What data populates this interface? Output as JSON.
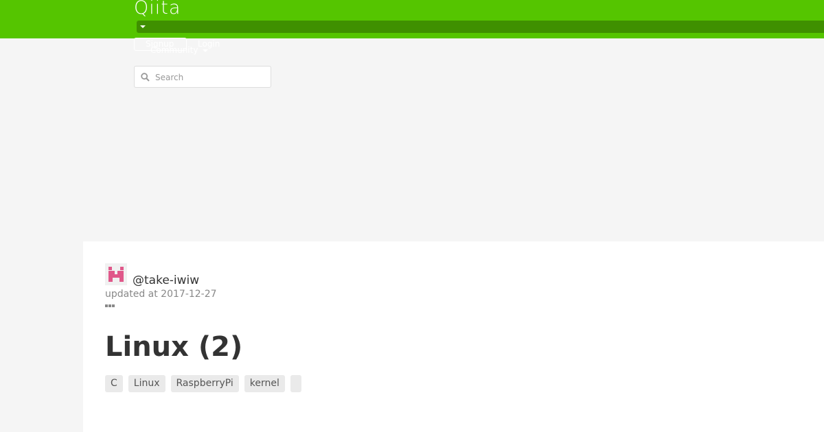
{
  "header": {
    "logo": "Qiita",
    "signup_label": "Signup",
    "login_label": "Login",
    "community_label": "Community",
    "search_placeholder": "Search"
  },
  "article": {
    "username": "@take-iwiw",
    "updated": "updated at 2017-12-27",
    "title": "Linux (2)",
    "tags": [
      "C",
      "Linux",
      "RaspberryPi",
      "kernel",
      ""
    ]
  },
  "colors": {
    "brand": "#55c500",
    "brand_dark": "#3f9000",
    "avatar": "#e0588a"
  },
  "icons": {
    "search": "search-icon",
    "menu_caret": "chevron-down-icon",
    "more": "more-dots-icon"
  }
}
